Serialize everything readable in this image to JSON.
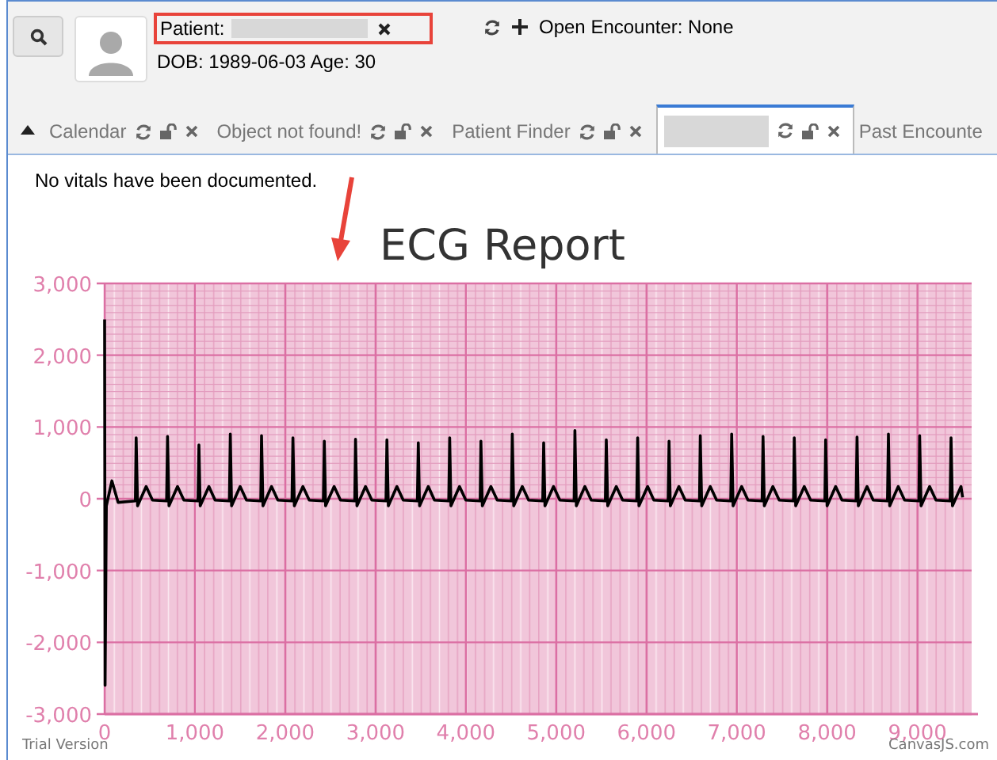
{
  "header": {
    "patient_label": "Patient:",
    "patient_name_redacted": true,
    "dob": "DOB: 1989-06-03 Age: 30",
    "encounter": "Open Encounter: None"
  },
  "tabs": [
    {
      "label": "Calendar",
      "selected": false,
      "icons": true
    },
    {
      "label": "Object not found!",
      "selected": false,
      "icons": true
    },
    {
      "label": "Patient Finder",
      "selected": false,
      "icons": true
    },
    {
      "redacted": true,
      "selected": true,
      "icons": true
    },
    {
      "label": "Past Encounte",
      "selected": false,
      "icons": false
    }
  ],
  "vitals_message": "No vitals have been documented.",
  "chart": {
    "chart_data": {
      "type": "line",
      "title": "ECG Report",
      "grid": true,
      "xlim": [
        0,
        9600
      ],
      "ylim": [
        -3000,
        3000
      ],
      "xticks": [
        {
          "value": 0,
          "label": "0"
        },
        {
          "value": 1000,
          "label": "1,000"
        },
        {
          "value": 2000,
          "label": "2,000"
        },
        {
          "value": 3000,
          "label": "3,000"
        },
        {
          "value": 4000,
          "label": "4,000"
        },
        {
          "value": 5000,
          "label": "5,000"
        },
        {
          "value": 6000,
          "label": "6,000"
        },
        {
          "value": 7000,
          "label": "7,000"
        },
        {
          "value": 8000,
          "label": "8,000"
        },
        {
          "value": 9000,
          "label": "9,000"
        }
      ],
      "yticks": [
        {
          "value": -3000,
          "label": "-3,000"
        },
        {
          "value": -2000,
          "label": "-2,000"
        },
        {
          "value": -1000,
          "label": "-1,000"
        },
        {
          "value": 0,
          "label": "0"
        },
        {
          "value": 1000,
          "label": "1,000"
        },
        {
          "value": 2000,
          "label": "2,000"
        },
        {
          "value": 3000,
          "label": "3,000"
        }
      ],
      "x": [
        0,
        5,
        20,
        80,
        150,
        340,
        350,
        365,
        460,
        530,
        687,
        697,
        712,
        807,
        877,
        1034,
        1044,
        1059,
        1154,
        1224,
        1381,
        1391,
        1406,
        1501,
        1571,
        1728,
        1738,
        1753,
        1848,
        1918,
        2075,
        2085,
        2100,
        2195,
        2265,
        2422,
        2432,
        2447,
        2542,
        2612,
        2769,
        2779,
        2794,
        2889,
        2959,
        3116,
        3126,
        3141,
        3236,
        3306,
        3463,
        3473,
        3488,
        3583,
        3653,
        3810,
        3820,
        3835,
        3930,
        4000,
        4157,
        4167,
        4182,
        4277,
        4347,
        4504,
        4514,
        4529,
        4624,
        4694,
        4851,
        4861,
        4876,
        4971,
        5041,
        5198,
        5208,
        5223,
        5318,
        5388,
        5545,
        5555,
        5570,
        5665,
        5735,
        5892,
        5902,
        5917,
        6012,
        6082,
        6239,
        6249,
        6264,
        6359,
        6429,
        6586,
        6596,
        6611,
        6706,
        6776,
        6933,
        6943,
        6958,
        7053,
        7123,
        7280,
        7290,
        7305,
        7400,
        7470,
        7627,
        7637,
        7652,
        7747,
        7817,
        7974,
        7984,
        7999,
        8094,
        8164,
        8321,
        8331,
        8346,
        8441,
        8511,
        8668,
        8678,
        8693,
        8788,
        8858,
        9015,
        9025,
        9040,
        9135,
        9205,
        9362,
        9372,
        9387,
        9482,
        9500
      ],
      "series": [
        {
          "color": "#000000",
          "values": [
            2500,
            -2600,
            -100,
            250,
            -50,
            -30,
            850,
            -100,
            170,
            -20,
            -30,
            870,
            -100,
            170,
            -20,
            -30,
            750,
            -100,
            170,
            -20,
            -30,
            900,
            -100,
            170,
            -20,
            -30,
            880,
            -100,
            170,
            -20,
            -30,
            850,
            -100,
            170,
            -20,
            -30,
            800,
            -100,
            170,
            -20,
            -30,
            830,
            -100,
            170,
            -20,
            -30,
            820,
            -100,
            170,
            -20,
            -30,
            780,
            -100,
            170,
            -20,
            -30,
            850,
            -100,
            170,
            -20,
            -30,
            800,
            -100,
            170,
            -20,
            -30,
            900,
            -100,
            170,
            -20,
            -30,
            780,
            -100,
            170,
            -20,
            -30,
            950,
            -100,
            170,
            -20,
            -30,
            820,
            -100,
            170,
            -20,
            -30,
            850,
            -100,
            170,
            -20,
            -30,
            800,
            -100,
            170,
            -20,
            -30,
            880,
            -100,
            170,
            -20,
            -30,
            900,
            -100,
            170,
            -20,
            -30,
            870,
            -100,
            170,
            -20,
            -30,
            850,
            -100,
            170,
            -20,
            -30,
            820,
            -100,
            170,
            -20,
            -30,
            860,
            -100,
            170,
            -20,
            -30,
            900,
            -100,
            170,
            -20,
            -30,
            880,
            -100,
            170,
            -20,
            -30,
            850,
            -100,
            170,
            20
          ]
        }
      ]
    }
  },
  "footer": {
    "left": "Trial Version",
    "right": "CanvasJS.com"
  }
}
